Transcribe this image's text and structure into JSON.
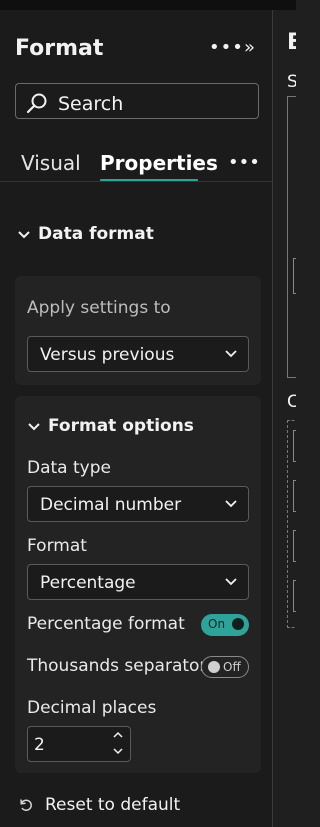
{
  "header": {
    "title": "Format",
    "more_label": "•••",
    "collapse_label": "»"
  },
  "search": {
    "placeholder": "Search"
  },
  "tabs": [
    {
      "label": "Visual"
    },
    {
      "label": "Properties",
      "active": true
    }
  ],
  "tab_more_label": "•••",
  "data_format": {
    "title": "Data format",
    "apply_settings": {
      "label": "Apply settings to",
      "value": "Versus previous"
    },
    "format_options": {
      "title": "Format options",
      "data_type": {
        "label": "Data type",
        "value": "Decimal number"
      },
      "format": {
        "label": "Format",
        "value": "Percentage"
      },
      "percentage_format": {
        "label": "Percentage format",
        "state": "On"
      },
      "thousands_separator": {
        "label": "Thousands separator",
        "state": "Off"
      },
      "decimal_places": {
        "label": "Decimal places",
        "value": "2"
      }
    }
  },
  "reset_label": "Reset to default",
  "right_panel": {
    "title_fragment": "B",
    "label_s": "S",
    "label_c": "C"
  },
  "colors": {
    "accent": "#2fa39a",
    "background": "#1b1b1b",
    "card": "#232323",
    "text": "#f2f2f2"
  },
  "icons": [
    "search-icon",
    "more-icon",
    "collapse-icon",
    "chevron-down-icon",
    "reset-icon",
    "spinner-up-icon",
    "spinner-down-icon"
  ]
}
